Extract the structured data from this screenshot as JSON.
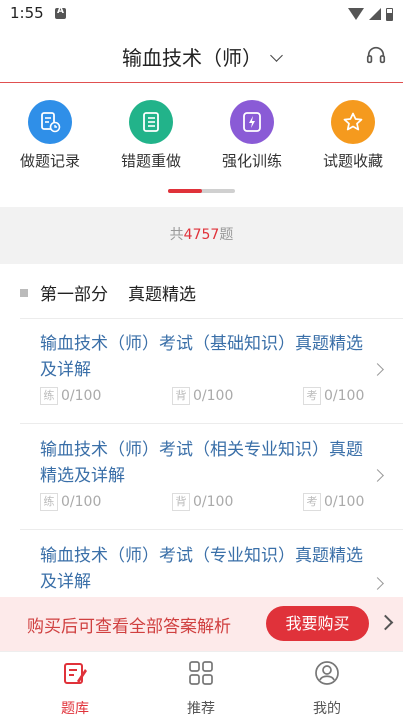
{
  "status_bar": {
    "time": "1:55"
  },
  "header": {
    "title": "输血技术（师）"
  },
  "features": [
    {
      "label": "做题记录",
      "icon": "history-icon",
      "color": "#2f8fe8"
    },
    {
      "label": "错题重做",
      "icon": "wrong-list-icon",
      "color": "#22b38a"
    },
    {
      "label": "强化训练",
      "icon": "lightning-icon",
      "color": "#8a5bd6"
    },
    {
      "label": "试题收藏",
      "icon": "star-icon",
      "color": "#f59a1e"
    }
  ],
  "page_indicator": {
    "active_fraction": 0.5
  },
  "count": {
    "prefix": "共",
    "number": "4757",
    "suffix": "题"
  },
  "section": {
    "square": "",
    "part": "第一部分",
    "name": "真题精选"
  },
  "items": [
    {
      "title": "输血技术（师）考试（基础知识）真题精选及详解",
      "practice_tag": "练",
      "practice": "0/100",
      "recite_tag": "背",
      "recite": "0/100",
      "exam_tag": "考",
      "exam": "0/100"
    },
    {
      "title": "输血技术（师）考试（相关专业知识）真题精选及详解",
      "practice_tag": "练",
      "practice": "0/100",
      "recite_tag": "背",
      "recite": "0/100",
      "exam_tag": "考",
      "exam": "0/100"
    },
    {
      "title": "输血技术（师）考试（专业知识）真题精选及详解"
    }
  ],
  "buy_banner": {
    "text": "购买后可查看全部答案解析",
    "button": "我要购买"
  },
  "bottom_nav": [
    {
      "label": "题库",
      "icon": "question-bank-icon",
      "active": true
    },
    {
      "label": "推荐",
      "icon": "grid-icon",
      "active": false
    },
    {
      "label": "我的",
      "icon": "profile-icon",
      "active": false
    }
  ],
  "colors": {
    "accent": "#e0323a",
    "link": "#3a6fa8"
  }
}
